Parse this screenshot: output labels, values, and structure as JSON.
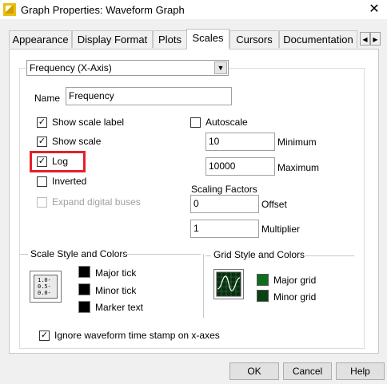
{
  "window": {
    "title": "Graph Properties: Waveform Graph",
    "close_glyph": "✕"
  },
  "tabs": [
    {
      "label": "Appearance"
    },
    {
      "label": "Display Format"
    },
    {
      "label": "Plots"
    },
    {
      "label": "Scales"
    },
    {
      "label": "Cursors"
    },
    {
      "label": "Documentation"
    }
  ],
  "tab_scroll": {
    "left": "◀",
    "right": "▶"
  },
  "axis_select": {
    "value": "Frequency (X-Axis)",
    "arrow": "▼"
  },
  "name": {
    "label": "Name",
    "value": "Frequency"
  },
  "options": {
    "show_scale_label": {
      "label": "Show scale label",
      "checked": true
    },
    "show_scale": {
      "label": "Show scale",
      "checked": true
    },
    "log": {
      "label": "Log",
      "checked": true
    },
    "inverted": {
      "label": "Inverted",
      "checked": false
    },
    "expand_digital_buses": {
      "label": "Expand digital buses",
      "checked": false,
      "disabled": true
    },
    "autoscale": {
      "label": "Autoscale",
      "checked": false
    }
  },
  "check_mark": "✓",
  "minimum": {
    "label": "Minimum",
    "value": "10"
  },
  "maximum": {
    "label": "Maximum",
    "value": "10000"
  },
  "scaling_factors": {
    "title": "Scaling Factors",
    "offset": {
      "label": "Offset",
      "value": "0"
    },
    "multiplier": {
      "label": "Multiplier",
      "value": "1"
    }
  },
  "scale_style": {
    "title": "Scale Style and Colors",
    "icon_ticks": [
      "1.0-",
      "0.5-",
      "0.0-"
    ],
    "major_tick": "Major tick",
    "minor_tick": "Minor tick",
    "marker_text": "Marker text",
    "colors": {
      "major_tick": "#000000",
      "minor_tick": "#000000",
      "marker_text": "#000000"
    }
  },
  "grid_style": {
    "title": "Grid Style and Colors",
    "major_grid": "Major grid",
    "minor_grid": "Minor grid",
    "colors": {
      "major_grid": "#0e6d1e",
      "minor_grid": "#0a4214"
    }
  },
  "ignore_timestamp": {
    "label": "Ignore waveform time stamp on x-axes",
    "checked": true
  },
  "buttons": {
    "ok": "OK",
    "cancel": "Cancel",
    "help": "Help"
  },
  "highlight_color": "#e5202a"
}
